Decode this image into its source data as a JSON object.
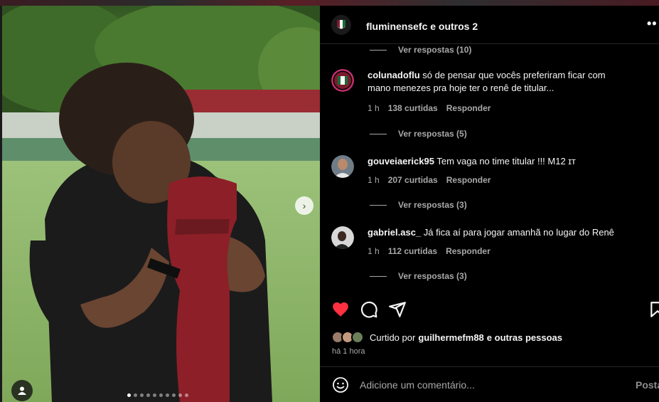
{
  "post": {
    "author_line": "fluminensefc e outros 2",
    "more_icon": "more-horizontal-icon"
  },
  "media": {
    "slide_count": 10,
    "active_slide": 1,
    "next_icon": "chevron-right-icon",
    "tag_icon": "user-tag-icon"
  },
  "comments": [
    {
      "username": "colunadoflu",
      "text": "só de pensar que vocês preferiram ficar com mano menezes pra hoje ter o renê de titular...",
      "time": "1 h",
      "likes": "138 curtidas",
      "reply": "Responder",
      "view_replies": "Ver respostas (5)"
    },
    {
      "username": "gouveiaerick95",
      "text": "Tem vaga no time titular !!! M12 ɪᴛ",
      "time": "1 h",
      "likes": "207 curtidas",
      "reply": "Responder",
      "view_replies": "Ver respostas (3)"
    },
    {
      "username": "gabriel.asc_",
      "text": "Já fica aí para jogar amanhã no lugar do Renê",
      "time": "1 h",
      "likes": "112 curtidas",
      "reply": "Responder",
      "view_replies": "Ver respostas (3)"
    }
  ],
  "previous_view_replies": "Ver respostas (10)",
  "actions": {
    "like_icon": "heart-filled-icon",
    "comment_icon": "comment-icon",
    "share_icon": "send-icon",
    "save_icon": "bookmark-icon",
    "like_color": "#ff3040"
  },
  "likes": {
    "prefix": "Curtido por",
    "user": "guilhermefm88",
    "suffix": "e outras pessoas"
  },
  "timestamp": "há 1 hora",
  "composer": {
    "placeholder": "Adicione um comentário...",
    "post_label": "Postar",
    "emoji_icon": "emoji-icon"
  }
}
